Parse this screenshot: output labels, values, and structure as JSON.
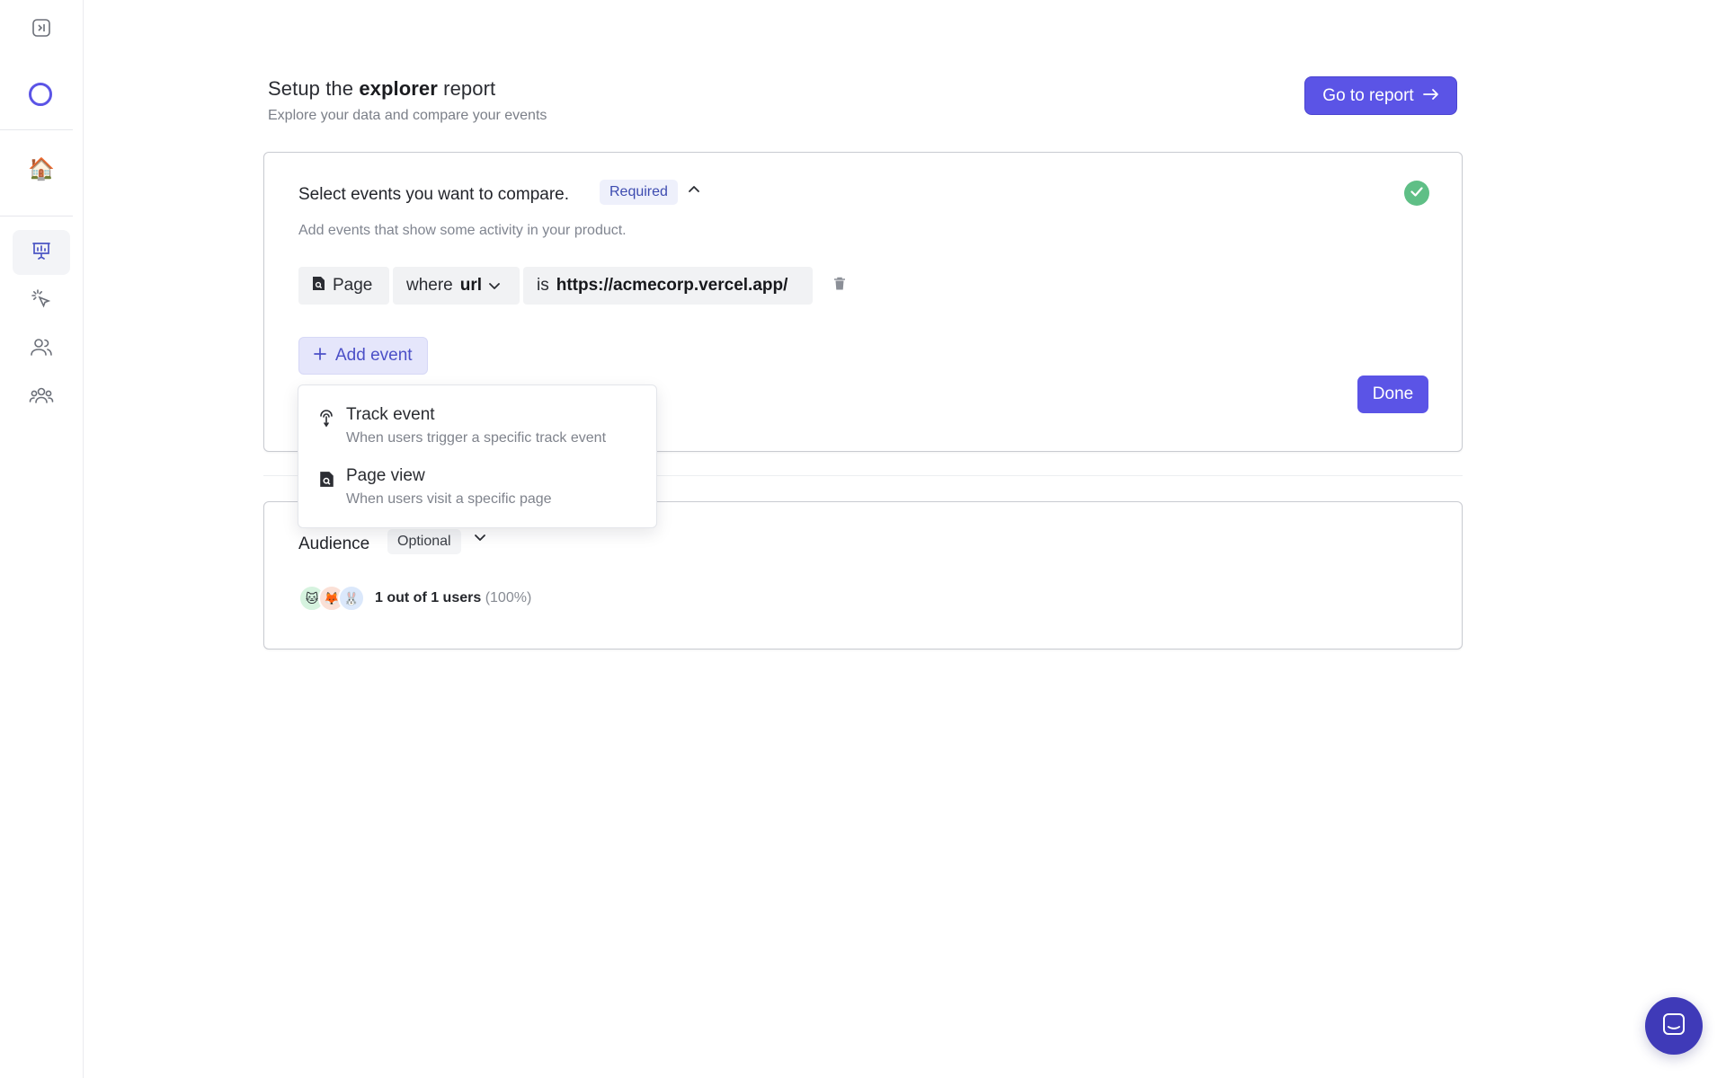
{
  "sidebar": {
    "home_emoji": "🏠",
    "items": [
      {
        "name": "collapse-sidebar",
        "icon": "panel-toggle-icon"
      },
      {
        "name": "workspace-logo",
        "icon": "circle-logo"
      },
      {
        "name": "home",
        "icon": "house-emoji"
      },
      {
        "name": "reports",
        "icon": "presentation-chart-icon",
        "active": true
      },
      {
        "name": "events",
        "icon": "cursor-click-icon"
      },
      {
        "name": "people",
        "icon": "users-icon"
      },
      {
        "name": "groups",
        "icon": "user-group-icon"
      }
    ]
  },
  "header": {
    "title_prefix": "Setup the",
    "title_bold": "explorer",
    "title_suffix": "report",
    "subtitle": "Explore your data and compare your events",
    "go_label": "Go to report",
    "go_icon": "arrow-right-icon"
  },
  "events_section": {
    "title": "Select events you want to compare.",
    "badge": "Required",
    "hint": "Add events that show some activity in your product.",
    "filter": {
      "type_label": "Page",
      "where_label": "where",
      "property": "url",
      "operator": "is",
      "value": "https://acmecorp.vercel.app/"
    },
    "add_label": "Add event",
    "done_label": "Done"
  },
  "add_menu": {
    "items": [
      {
        "label": "Track event",
        "desc": "When users trigger a specific track event",
        "icon": "touch-pointer-icon"
      },
      {
        "label": "Page view",
        "desc": "When users visit a specific page",
        "icon": "page-search-icon"
      }
    ]
  },
  "audience": {
    "title": "Audience",
    "badge": "Optional",
    "count_text": "1 out of 1 users",
    "percent_text": "(100%)",
    "avatars": [
      "🐱",
      "🦊",
      "🐰"
    ]
  },
  "colors": {
    "accent": "#5b54e6",
    "success": "#5fbf86"
  }
}
